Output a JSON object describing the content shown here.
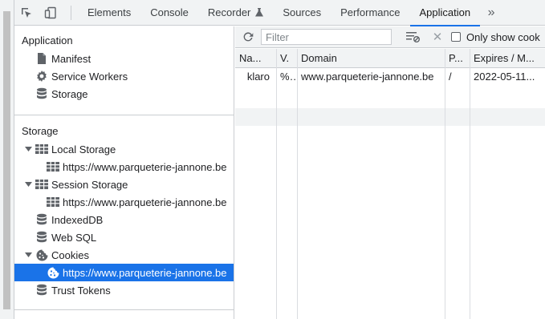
{
  "toolbar": {
    "tabs": [
      {
        "label": "Elements"
      },
      {
        "label": "Console"
      },
      {
        "label": "Recorder"
      },
      {
        "label": "Sources"
      },
      {
        "label": "Performance"
      },
      {
        "label": "Application"
      }
    ],
    "active_tab": "Application",
    "more_glyph": "»"
  },
  "sidebar": {
    "application": {
      "title": "Application",
      "items": [
        {
          "label": "Manifest",
          "icon": "file-icon"
        },
        {
          "label": "Service Workers",
          "icon": "gear-icon"
        },
        {
          "label": "Storage",
          "icon": "database-icon"
        }
      ]
    },
    "storage": {
      "title": "Storage",
      "local_storage": {
        "label": "Local Storage",
        "child": "https://www.parqueterie-jannone.be"
      },
      "session_storage": {
        "label": "Session Storage",
        "child": "https://www.parqueterie-jannone.be"
      },
      "indexeddb": {
        "label": "IndexedDB"
      },
      "websql": {
        "label": "Web SQL"
      },
      "cookies": {
        "label": "Cookies",
        "child": "https://www.parqueterie-jannone.be"
      },
      "trust_tokens": {
        "label": "Trust Tokens"
      }
    }
  },
  "panel": {
    "filter_placeholder": "Filter",
    "only_show_label": "Only show cook",
    "columns": [
      "Na...",
      "V.",
      "Domain",
      "P...",
      "Expires / M..."
    ],
    "rows": [
      {
        "name": "klaro",
        "value": "%...",
        "domain": "www.parqueterie-jannone.be",
        "path": "/",
        "expires": "2022-05-11..."
      }
    ]
  },
  "colors": {
    "accent": "#1a73e8",
    "toolbar_bg": "#f1f3f4",
    "border": "#cacdd1"
  }
}
